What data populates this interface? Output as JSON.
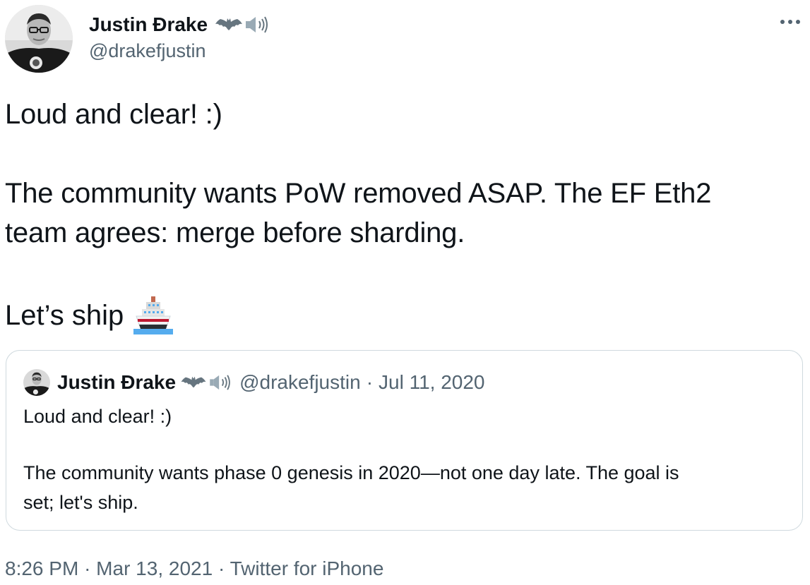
{
  "author": {
    "name": "Justin Ðrake",
    "handle": "@drakefjustin",
    "name_emojis": [
      "bat-icon",
      "speaker-icon"
    ]
  },
  "menu": {
    "more_icon": "more-horizontal-icon"
  },
  "tweet": {
    "lines": [
      "Loud and clear! :)",
      "The community wants PoW removed ASAP. The EF Eth2",
      "team agrees: merge before sharding.",
      "Let’s ship"
    ],
    "ship_emoji": "ship-icon"
  },
  "quote": {
    "name": "Justin Ðrake",
    "handle": "@drakefjustin",
    "separator": "·",
    "date": "Jul 11, 2020",
    "lines": [
      "Loud and clear! :)",
      "The community wants phase 0 genesis in 2020—not one day late. The goal is",
      "set; let's ship."
    ]
  },
  "footer": {
    "time": "8:26 PM",
    "separator": "·",
    "date": "Mar 13, 2021",
    "source": "Twitter for iPhone"
  },
  "colors": {
    "text": "#0f1419",
    "secondary": "#536471",
    "border": "#cfd9de"
  }
}
